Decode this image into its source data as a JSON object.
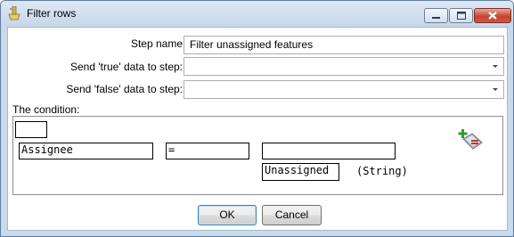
{
  "window": {
    "title": "Filter rows",
    "app_icon": "kettle-spoon-icon",
    "controls": [
      "minimize-icon",
      "maximize-icon",
      "close-icon"
    ]
  },
  "form": {
    "step_name_label": "Step name",
    "step_name_value": "Filter unassigned features",
    "true_step_label": "Send 'true' data to step:",
    "true_step_value": "",
    "false_step_label": "Send 'false' data to step:",
    "false_step_value": ""
  },
  "condition": {
    "label": "The condition:",
    "negate_value": "",
    "left_field": "Assignee",
    "operator": "=",
    "right_field": "",
    "constant_value": "Unassigned",
    "constant_type": "(String)",
    "add_icon": "add-condition-icon"
  },
  "buttons": {
    "ok": "OK",
    "cancel": "Cancel"
  }
}
